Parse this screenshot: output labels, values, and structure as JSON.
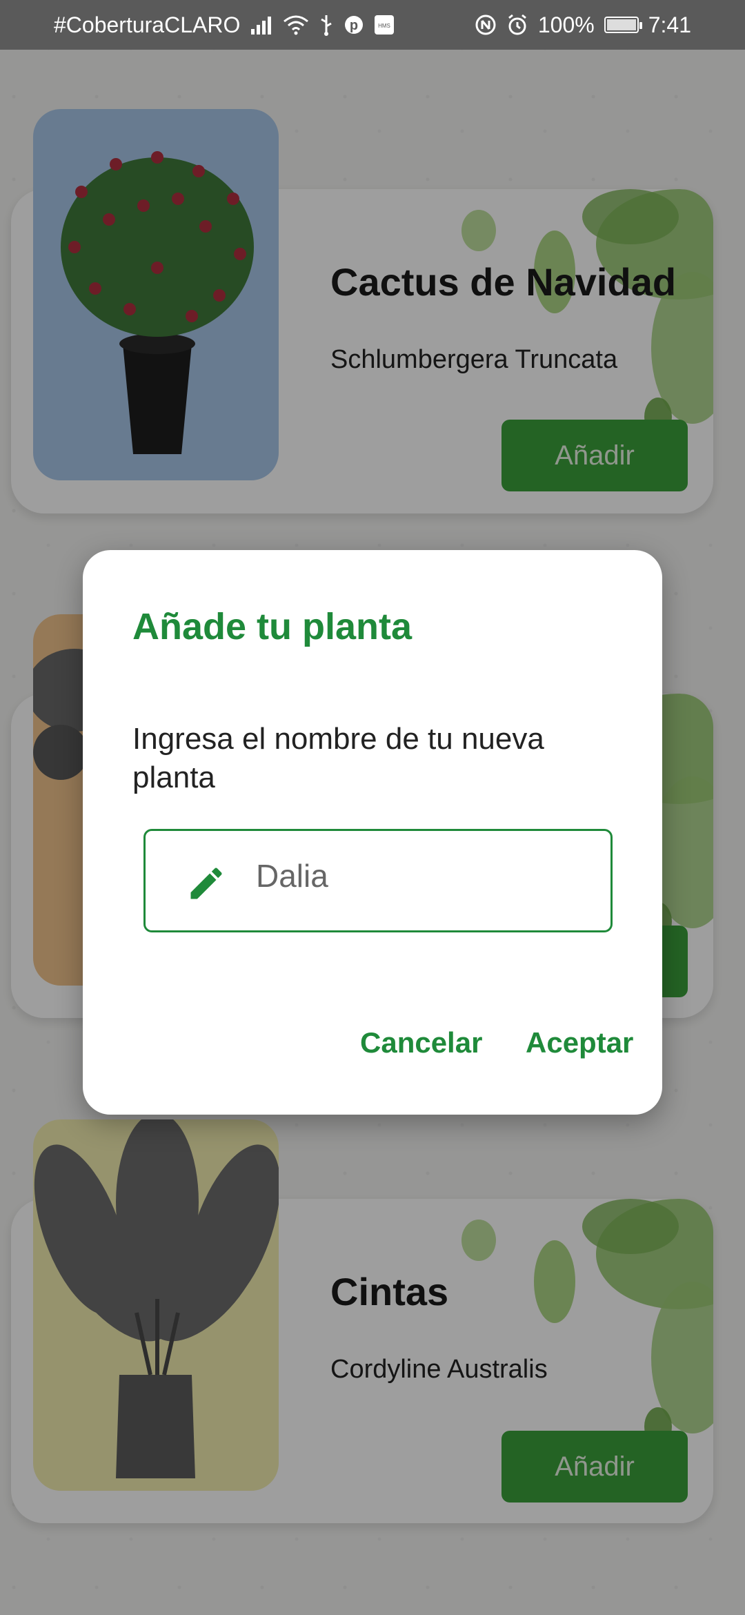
{
  "status_bar": {
    "carrier": "#CoberturaCLARO",
    "battery": "100%",
    "time": "7:41",
    "icons": [
      "signal-icon",
      "wifi-icon",
      "usb-icon",
      "pinterest-icon",
      "hms-icon",
      "nfc-icon",
      "alarm-icon",
      "battery-charging-icon"
    ]
  },
  "cards": [
    {
      "name": "Cactus de Navidad",
      "scientific": "Schlumbergera Truncata",
      "button_label": "Añadir",
      "photo_bg": "#a9c7e8"
    },
    {
      "name": "",
      "scientific": "",
      "button_label": "",
      "photo_bg": "#f1c48d"
    },
    {
      "name": "Cintas",
      "scientific": "Cordyline Australis",
      "button_label": "Añadir",
      "photo_bg": "#f2eeb0"
    }
  ],
  "dialog": {
    "title": "Añade tu planta",
    "message": "Ingresa el nombre de tu nueva planta",
    "input_value": "Dalia",
    "cancel_label": "Cancelar",
    "accept_label": "Aceptar"
  },
  "colors": {
    "accent": "#1f8a3a",
    "button": "#3aa03a"
  }
}
